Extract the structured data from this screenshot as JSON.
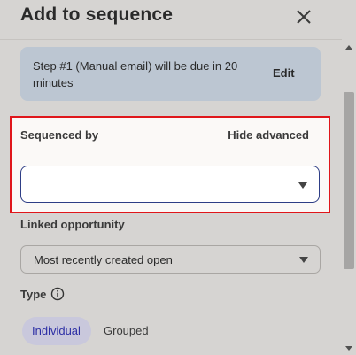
{
  "header": {
    "title": "Add to sequence",
    "close_icon": "close-icon"
  },
  "info_box": {
    "text": "Step #1 (Manual email) will be due in 20 minutes",
    "edit_label": "Edit"
  },
  "sequenced_by": {
    "label": "Sequenced by",
    "hide_advanced_label": "Hide advanced",
    "value": ""
  },
  "linked_opportunity": {
    "label": "Linked opportunity",
    "value": "Most recently created open"
  },
  "type": {
    "label": "Type",
    "info_icon": "info-circle-icon",
    "options": [
      "Individual",
      "Grouped"
    ],
    "selected": "Individual"
  },
  "colors": {
    "highlight_border": "#e0161b",
    "info_box_bg": "#bcc6d2",
    "selected_toggle_bg": "#c9c8dc",
    "selected_toggle_text": "#2d2fa5",
    "focused_select_border": "#2e3e86"
  }
}
